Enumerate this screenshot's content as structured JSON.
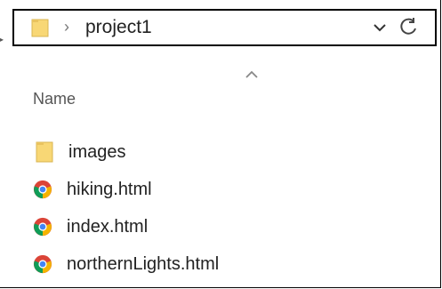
{
  "address_bar": {
    "path_separator": "›",
    "current_folder": "project1",
    "dropdown_icon": "chevron-down-icon",
    "refresh_icon": "refresh-icon"
  },
  "column_header": {
    "name_label": "Name",
    "sort_indicator": "caret-up-icon"
  },
  "files": [
    {
      "name": "images",
      "icon": "folder-icon"
    },
    {
      "name": "hiking.html",
      "icon": "chrome-html-icon"
    },
    {
      "name": "index.html",
      "icon": "chrome-html-icon"
    },
    {
      "name": "northernLights.html",
      "icon": "chrome-html-icon"
    }
  ],
  "colors": {
    "folder": "#F8D775",
    "chrome_red": "#DB4437",
    "chrome_green": "#0F9D58",
    "chrome_yellow": "#F4B400",
    "chrome_blue": "#4285F4"
  }
}
